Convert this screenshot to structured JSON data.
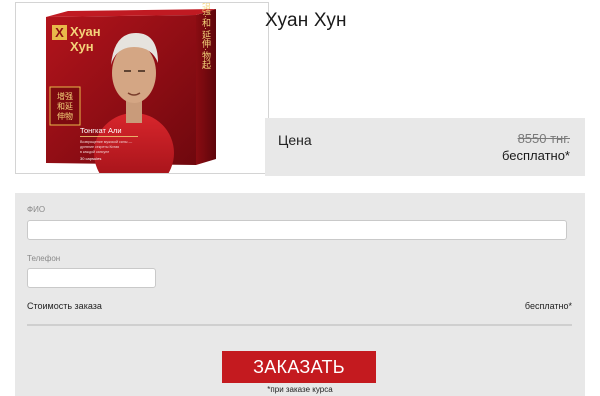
{
  "product": {
    "title": "Хуан Хун",
    "box": {
      "brand_line1": "Хуан",
      "brand_line2": "Хун",
      "cn_left": "增强和延伸物起",
      "cn_right": "增强·和·延伸·物起",
      "product_name": "Тонгкат Али",
      "description": "Возвращение мужской силы — древние секреты Китая в каждой капсуле",
      "capsules": "30 capsules"
    }
  },
  "price": {
    "label": "Цена",
    "old": "8550 тнг.",
    "new": "бесплатно*"
  },
  "form": {
    "name_label": "ФИО",
    "name_value": "",
    "phone_label": "Телефон",
    "phone_value": "",
    "summary_label": "Стоимость заказа",
    "summary_value": "бесплатно*",
    "submit_label": "ЗАКАЗАТЬ",
    "footnote": "*при заказе курса"
  },
  "colors": {
    "accent": "#c41a1f",
    "panel": "#e8e8e8"
  }
}
